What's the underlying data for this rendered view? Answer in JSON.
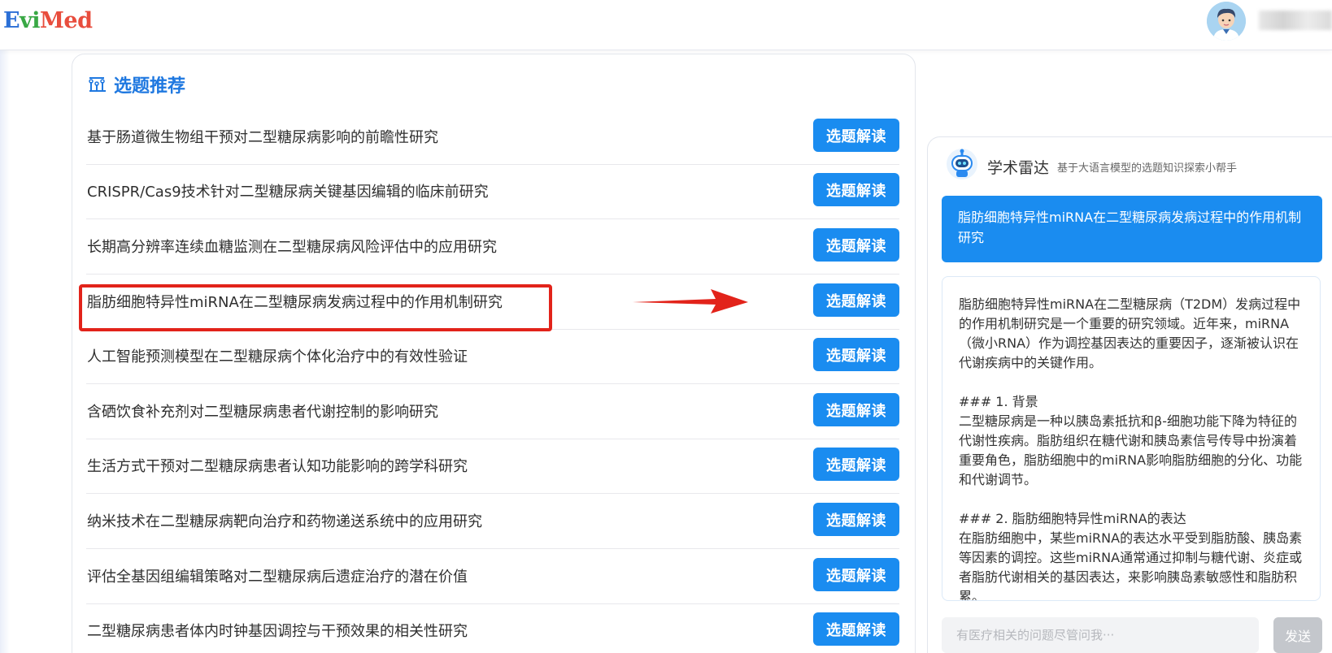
{
  "header": {
    "logo_parts": [
      "E",
      "vi",
      "Med"
    ],
    "username": ""
  },
  "topics": {
    "title": "选题推荐",
    "button_label": "选题解读",
    "items": [
      "基于肠道微生物组干预对二型糖尿病影响的前瞻性研究",
      "CRISPR/Cas9技术针对二型糖尿病关键基因编辑的临床前研究",
      "长期高分辨率连续血糖监测在二型糖尿病风险评估中的应用研究",
      "脂肪细胞特异性miRNA在二型糖尿病发病过程中的作用机制研究",
      "人工智能预测模型在二型糖尿病个体化治疗中的有效性验证",
      "含硒饮食补充剂对二型糖尿病患者代谢控制的影响研究",
      "生活方式干预对二型糖尿病患者认知功能影响的跨学科研究",
      "纳米技术在二型糖尿病靶向治疗和药物递送系统中的应用研究",
      "评估全基因组编辑策略对二型糖尿病后遗症治疗的潜在价值",
      "二型糖尿病患者体内时钟基因调控与干预效果的相关性研究"
    ],
    "highlighted_index": 3
  },
  "chat": {
    "title": "学术雷达",
    "subtitle": "基于大语言模型的选题知识探索小帮手",
    "user_message": "脂肪细胞特异性miRNA在二型糖尿病发病过程中的作用机制研究",
    "answer": "脂肪细胞特异性miRNA在二型糖尿病（T2DM）发病过程中的作用机制研究是一个重要的研究领域。近年来，miRNA（微小RNA）作为调控基因表达的重要因子，逐渐被认识在代谢疾病中的关键作用。\n\n### 1. 背景\n二型糖尿病是一种以胰岛素抵抗和β-细胞功能下降为特征的代谢性疾病。脂肪组织在糖代谢和胰岛素信号传导中扮演着重要角色，脂肪细胞中的miRNA影响脂肪细胞的分化、功能和代谢调节。\n\n### 2. 脂肪细胞特异性miRNA的表达\n在脂肪细胞中，某些miRNA的表达水平受到脂肪酸、胰岛素等因素的调控。这些miRNA通常通过抑制与糖代谢、炎症或者脂肪代谢相关的基因表达，来影响胰岛素敏感性和脂肪积累。",
    "input_placeholder": "有医疗相关的问题尽管问我···",
    "send_label": "发送"
  },
  "colors": {
    "accent": "#1a8cf0",
    "highlight": "#e2231a",
    "logo_blue": "#2b6fd6",
    "logo_green": "#39a845",
    "logo_red": "#e84d3d"
  }
}
